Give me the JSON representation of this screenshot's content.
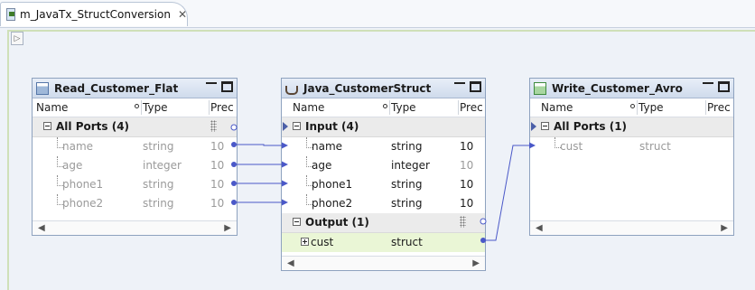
{
  "editor": {
    "tab_title": "m_JavaTx_StructConversion",
    "close_glyph": "✕",
    "canvas_toggle_glyph": "▷"
  },
  "columns": {
    "name": "Name",
    "type": "Type",
    "precision": "Prec"
  },
  "panels": {
    "read": {
      "title": "Read_Customer_Flat",
      "group": "All Ports (4)",
      "ports": [
        {
          "name": "name",
          "type": "string",
          "prec": "10"
        },
        {
          "name": "age",
          "type": "integer",
          "prec": "10"
        },
        {
          "name": "phone1",
          "type": "string",
          "prec": "10"
        },
        {
          "name": "phone2",
          "type": "string",
          "prec": "10"
        }
      ]
    },
    "java": {
      "title": "Java_CustomerStruct",
      "input_group": "Input (4)",
      "input_ports": [
        {
          "name": "name",
          "type": "string",
          "prec": "10"
        },
        {
          "name": "age",
          "type": "integer",
          "prec": "10"
        },
        {
          "name": "phone1",
          "type": "string",
          "prec": "10"
        },
        {
          "name": "phone2",
          "type": "string",
          "prec": "10"
        }
      ],
      "output_group": "Output (1)",
      "output_ports": [
        {
          "name": "cust",
          "type": "struct"
        }
      ]
    },
    "write": {
      "title": "Write_Customer_Avro",
      "group": "All Ports (1)",
      "ports": [
        {
          "name": "cust",
          "type": "struct"
        }
      ]
    }
  },
  "colors": {
    "link": "#4a58c8",
    "panel_header": "#cfdbec",
    "output_highlight": "#eaf6d6"
  },
  "icons": {
    "tab": "mapping-icon",
    "read": "read-table-icon",
    "java": "java-cup-icon",
    "write": "write-table-icon"
  }
}
